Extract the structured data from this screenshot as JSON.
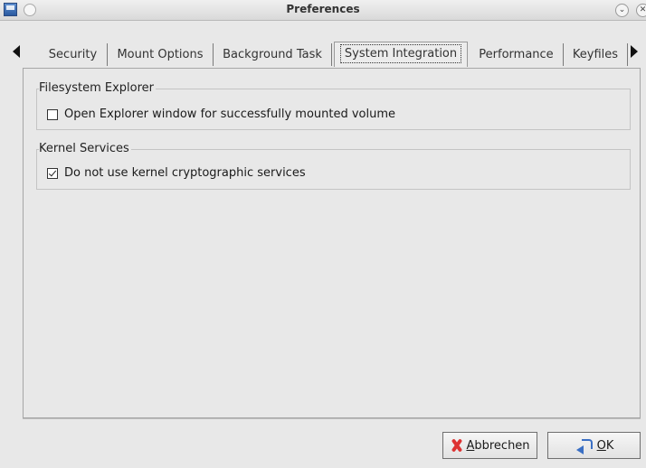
{
  "window": {
    "title": "Preferences"
  },
  "tabs": [
    {
      "label": "Security"
    },
    {
      "label": "Mount Options"
    },
    {
      "label": "Background Task"
    },
    {
      "label": "System Integration",
      "active": true
    },
    {
      "label": "Performance"
    },
    {
      "label": "Keyfiles"
    }
  ],
  "groups": {
    "explorer": {
      "title": "Filesystem Explorer",
      "option_label": "Open Explorer window for successfully mounted volume",
      "checked": false
    },
    "kernel": {
      "title": "Kernel Services",
      "option_label": "Do not use kernel cryptographic services",
      "checked": true
    }
  },
  "buttons": {
    "cancel": {
      "mnemonic": "A",
      "rest": "bbrechen"
    },
    "ok": {
      "mnemonic": "O",
      "rest": "K"
    }
  },
  "icons": {
    "app": "app-icon",
    "cancel": "red-x-icon",
    "ok": "enter-arrow-icon"
  },
  "colors": {
    "background": "#e8e8e8",
    "checkbox_mark": "#222222",
    "cancel_icon": "#dd3333",
    "ok_icon": "#3a6fc4"
  }
}
